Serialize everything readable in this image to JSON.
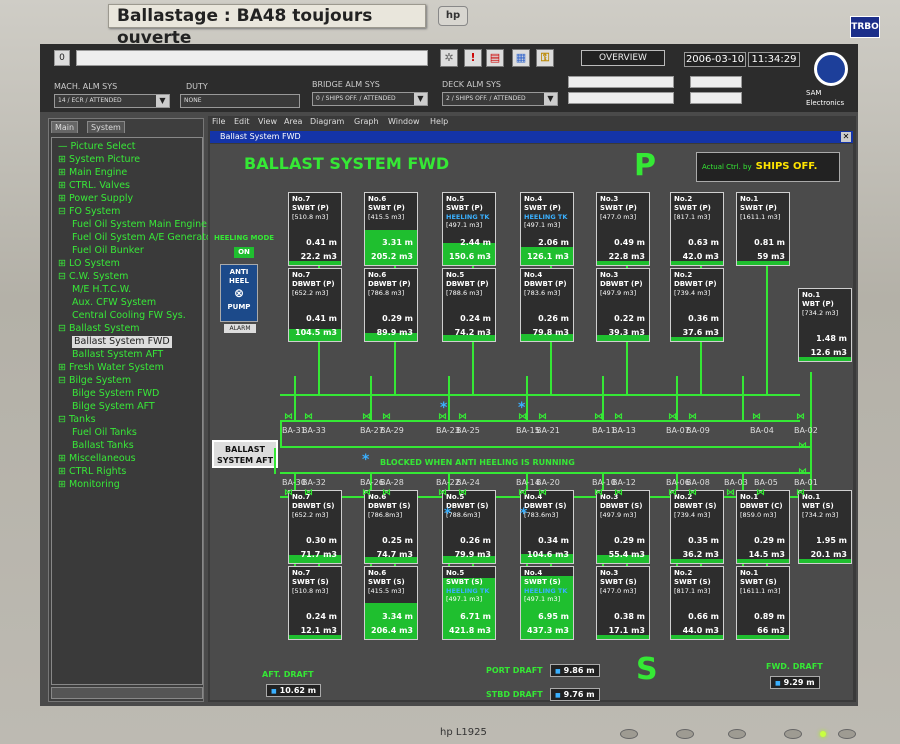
{
  "sticker_title": "Ballastage : BA48 toujours ouverte",
  "hp_logo": "hp",
  "sticker_right": "TRBO",
  "monitor_model": "hp L1925",
  "topbar": {
    "alarm_count": "0",
    "mach_alm_sys_label": "MACH. ALM SYS",
    "mach_alm_sys_value": "14 / ECR / ATTENDED",
    "duty_label": "DUTY",
    "duty_value": "NONE",
    "bridge_alm_sys_label": "BRIDGE ALM SYS",
    "bridge_alm_sys_value": "0 / SHIPS OFF. / ATTENDED",
    "deck_alm_sys_label": "DECK ALM SYS",
    "deck_alm_sys_value": "2 / SHIPS OFF. / ATTENDED",
    "overview_label": "OVERVIEW",
    "date": "2006-03-10",
    "time": "11:34:29",
    "brand_line1": "SAM",
    "brand_line2": "Electronics"
  },
  "sidebar": {
    "tabs": [
      "Main",
      "System"
    ],
    "items": [
      {
        "label": "Picture Select",
        "prefix": "—"
      },
      {
        "label": "System Picture",
        "prefix": "⊞"
      },
      {
        "label": "Main Engine",
        "prefix": "⊞"
      },
      {
        "label": "CTRL. Valves",
        "prefix": "⊞"
      },
      {
        "label": "Power Supply",
        "prefix": "⊞"
      },
      {
        "label": "FO System",
        "prefix": "⊟"
      },
      {
        "label": "Fuel Oil System Main Engine",
        "prefix": ""
      },
      {
        "label": "Fuel Oil System A/E Generator",
        "prefix": ""
      },
      {
        "label": "Fuel Oil Bunker",
        "prefix": ""
      },
      {
        "label": "LO System",
        "prefix": "⊞"
      },
      {
        "label": "C.W. System",
        "prefix": "⊟"
      },
      {
        "label": "M/E H.T.C.W.",
        "prefix": ""
      },
      {
        "label": "Aux. CFW System",
        "prefix": ""
      },
      {
        "label": "Central Cooling FW Sys.",
        "prefix": ""
      },
      {
        "label": "Ballast System",
        "prefix": "⊟"
      },
      {
        "label": "Ballast System FWD",
        "prefix": ""
      },
      {
        "label": "Ballast System AFT",
        "prefix": ""
      },
      {
        "label": "Fresh Water System",
        "prefix": "⊞"
      },
      {
        "label": "Bilge System",
        "prefix": "⊟"
      },
      {
        "label": "Bilge System FWD",
        "prefix": ""
      },
      {
        "label": "Bilge System AFT",
        "prefix": ""
      },
      {
        "label": "Tanks",
        "prefix": "⊟"
      },
      {
        "label": "Fuel Oil Tanks",
        "prefix": ""
      },
      {
        "label": "Ballast Tanks",
        "prefix": ""
      },
      {
        "label": "Miscellaneous",
        "prefix": "⊞"
      },
      {
        "label": "CTRL Rights",
        "prefix": "⊞"
      },
      {
        "label": "Monitoring",
        "prefix": "⊞"
      }
    ]
  },
  "menu": [
    "File",
    "Edit",
    "View",
    "Area",
    "Diagram",
    "Graph",
    "Window",
    "Help"
  ],
  "window_title": "Ballast System FWD",
  "diagram": {
    "heading": "BALLAST SYSTEM FWD",
    "port_letter": "P",
    "stbd_letter": "S",
    "actual_ctrl_label": "Actual Ctrl. by",
    "actual_ctrl_value": "SHIPS OFF.",
    "heeling_mode_label": "HEELING MODE",
    "heeling_on": "ON",
    "anti_heel_pump": [
      "ANTI",
      "HEEL",
      "PUMP"
    ],
    "alarm_label": "ALARM",
    "ballast_aft_button": [
      "BALLAST",
      "SYSTEM AFT"
    ],
    "blocked_note": "BLOCKED WHEN ANTI HEELING IS RUNNING",
    "star_glyph": "*",
    "valves_port": [
      "BA-31",
      "BA-33",
      "BA-27",
      "BA-29",
      "BA-23",
      "BA-25",
      "BA-15",
      "BA-21",
      "BA-11",
      "BA-13",
      "BA-07",
      "BA-09",
      "BA-04",
      "BA-02"
    ],
    "valves_stbd": [
      "BA-30",
      "BA-32",
      "BA-26",
      "BA-28",
      "BA-22",
      "BA-24",
      "BA-14",
      "BA-20",
      "BA-10",
      "BA-12",
      "BA-06",
      "BA-08",
      "BA-03",
      "BA-05",
      "BA-01"
    ],
    "aft_draft_label": "AFT. DRAFT",
    "aft_draft_value": "10.62 m",
    "port_draft_label": "PORT DRAFT",
    "port_draft_value": "9.86 m",
    "stbd_draft_label": "STBD DRAFT",
    "stbd_draft_value": "9.76 m",
    "fwd_draft_label": "FWD. DRAFT",
    "fwd_draft_value": "9.29 m",
    "draft_marker": "■"
  },
  "tanks": [
    {
      "no": "No.7",
      "type": "SWBT (P)",
      "cap": "[510.8 m3]",
      "level": "0.41 m",
      "vol": "22.2 m3",
      "fill": 0.04,
      "heeling": ""
    },
    {
      "no": "No.6",
      "type": "SWBT (P)",
      "cap": "[415.5 m3]",
      "level": "3.31 m",
      "vol": "205.2 m3",
      "fill": 0.49,
      "heeling": ""
    },
    {
      "no": "No.5",
      "type": "SWBT (P)",
      "cap": "[497.1 m3]",
      "level": "2.44 m",
      "vol": "150.6 m3",
      "fill": 0.3,
      "heeling": "HEELING TK"
    },
    {
      "no": "No.4",
      "type": "SWBT (P)",
      "cap": "[497.1 m3]",
      "level": "2.06 m",
      "vol": "126.1 m3",
      "fill": 0.25,
      "heeling": "HEELING TK"
    },
    {
      "no": "No.3",
      "type": "SWBT (P)",
      "cap": "[477.0 m3]",
      "level": "0.49 m",
      "vol": "22.8 m3",
      "fill": 0.05,
      "heeling": ""
    },
    {
      "no": "No.2",
      "type": "SWBT (P)",
      "cap": "[817.1 m3]",
      "level": "0.63 m",
      "vol": "42.0 m3",
      "fill": 0.05,
      "heeling": ""
    },
    {
      "no": "No.1",
      "type": "SWBT (P)",
      "cap": "[1611.1 m3]",
      "level": "0.81 m",
      "vol": "59 m3",
      "fill": 0.04,
      "heeling": ""
    },
    {
      "no": "No.7",
      "type": "DBWBT (P)",
      "cap": "[652.2 m3]",
      "level": "0.41 m",
      "vol": "104.5 m3",
      "fill": 0.16,
      "heeling": ""
    },
    {
      "no": "No.6",
      "type": "DBWBT (P)",
      "cap": "[786.8 m3]",
      "level": "0.29 m",
      "vol": "89.9 m3",
      "fill": 0.11,
      "heeling": ""
    },
    {
      "no": "No.5",
      "type": "DBWBT (P)",
      "cap": "[788.6 m3]",
      "level": "0.24 m",
      "vol": "74.2 m3",
      "fill": 0.09,
      "heeling": ""
    },
    {
      "no": "No.4",
      "type": "DBWBT (P)",
      "cap": "[783.6 m3]",
      "level": "0.26 m",
      "vol": "79.8 m3",
      "fill": 0.1,
      "heeling": ""
    },
    {
      "no": "No.3",
      "type": "DBWBT (P)",
      "cap": "[497.9 m3]",
      "level": "0.22 m",
      "vol": "39.3 m3",
      "fill": 0.08,
      "heeling": ""
    },
    {
      "no": "No.2",
      "type": "DBWBT (P)",
      "cap": "[739.4 m3]",
      "level": "0.36 m",
      "vol": "37.6 m3",
      "fill": 0.05,
      "heeling": ""
    },
    {
      "no": "No.1",
      "type": "WBT (P)",
      "cap": "[734.2 m3]",
      "level": "1.48 m",
      "vol": "12.6 m3",
      "fill": 0.02,
      "heeling": ""
    },
    {
      "no": "No.7",
      "type": "DBWBT (S)",
      "cap": "[652.2 m3]",
      "level": "0.30 m",
      "vol": "71.7 m3",
      "fill": 0.11,
      "heeling": ""
    },
    {
      "no": "No.6",
      "type": "DBWBT (S)",
      "cap": "[786.8m3]",
      "level": "0.25 m",
      "vol": "74.7 m3",
      "fill": 0.09,
      "heeling": ""
    },
    {
      "no": "No.5",
      "type": "DBWBT (S)",
      "cap": "[788.6m3]",
      "level": "0.26 m",
      "vol": "79.9 m3",
      "fill": 0.1,
      "heeling": ""
    },
    {
      "no": "No.4",
      "type": "DBWBT (S)",
      "cap": "[783.6m3]",
      "level": "0.34 m",
      "vol": "104.6 m3",
      "fill": 0.13,
      "heeling": ""
    },
    {
      "no": "No.3",
      "type": "DBWBT (S)",
      "cap": "[497.9 m3]",
      "level": "0.29 m",
      "vol": "55.4 m3",
      "fill": 0.11,
      "heeling": ""
    },
    {
      "no": "No.2",
      "type": "DBWBT (S)",
      "cap": "[739.4 m3]",
      "level": "0.35 m",
      "vol": "36.2 m3",
      "fill": 0.05,
      "heeling": ""
    },
    {
      "no": "No.1",
      "type": "DBWBT (C)",
      "cap": "[859.0 m3]",
      "level": "0.29 m",
      "vol": "14.5 m3",
      "fill": 0.02,
      "heeling": ""
    },
    {
      "no": "No.1",
      "type": "WBT (S)",
      "cap": "[734.2 m3]",
      "level": "1.95 m",
      "vol": "20.1 m3",
      "fill": 0.03,
      "heeling": ""
    },
    {
      "no": "No.7",
      "type": "SWBT (S)",
      "cap": "[510.8 m3]",
      "level": "0.24 m",
      "vol": "12.1 m3",
      "fill": 0.02,
      "heeling": ""
    },
    {
      "no": "No.6",
      "type": "SWBT (S)",
      "cap": "[415.5 m3]",
      "level": "3.34 m",
      "vol": "206.4 m3",
      "fill": 0.5,
      "heeling": ""
    },
    {
      "no": "No.5",
      "type": "SWBT (S)",
      "cap": "[497.1 m3]",
      "level": "6.71 m",
      "vol": "421.8 m3",
      "fill": 0.85,
      "heeling": "HEELING TK"
    },
    {
      "no": "No.4",
      "type": "SWBT (S)",
      "cap": "[497.1 m3]",
      "level": "6.95 m",
      "vol": "437.3 m3",
      "fill": 0.88,
      "heeling": "HEELING TK"
    },
    {
      "no": "No.3",
      "type": "SWBT (S)",
      "cap": "[477.0 m3]",
      "level": "0.38 m",
      "vol": "17.1 m3",
      "fill": 0.04,
      "heeling": ""
    },
    {
      "no": "No.2",
      "type": "SWBT (S)",
      "cap": "[817.1 m3]",
      "level": "0.66 m",
      "vol": "44.0 m3",
      "fill": 0.05,
      "heeling": ""
    },
    {
      "no": "No.1",
      "type": "SWBT (S)",
      "cap": "[1611.1 m3]",
      "level": "0.89 m",
      "vol": "66 m3",
      "fill": 0.04,
      "heeling": ""
    }
  ]
}
